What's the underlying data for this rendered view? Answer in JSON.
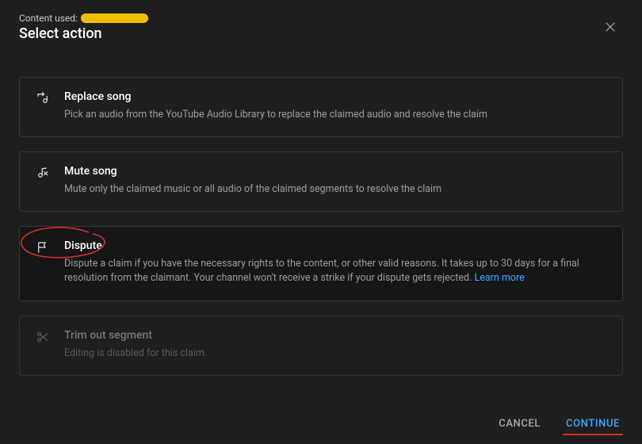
{
  "header": {
    "content_used_label": "Content used:",
    "title": "Select action"
  },
  "options": {
    "replace": {
      "title": "Replace song",
      "desc": "Pick an audio from the YouTube Audio Library to replace the claimed audio and resolve the claim"
    },
    "mute": {
      "title": "Mute song",
      "desc": "Mute only the claimed music or all audio of the claimed segments to resolve the claim"
    },
    "dispute": {
      "title": "Dispute",
      "desc": "Dispute a claim if you have the necessary rights to the content, or other valid reasons. It takes up to 30 days for a final resolution from the claimant. Your channel won't receive a strike if your dispute gets rejected. ",
      "learn_more": "Learn more"
    },
    "trim": {
      "title": "Trim out segment",
      "desc": "Editing is disabled for this claim."
    }
  },
  "footer": {
    "cancel": "CANCEL",
    "continue": "CONTINUE"
  }
}
